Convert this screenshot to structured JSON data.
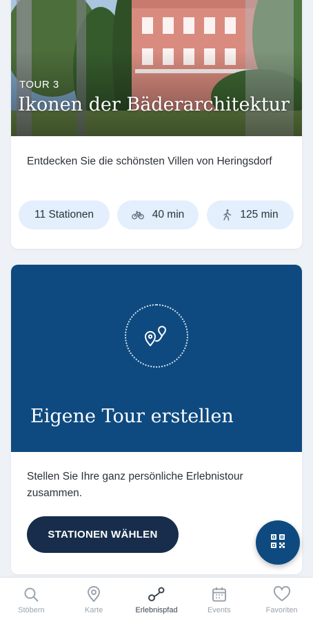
{
  "tour_card": {
    "eyebrow": "TOUR 3",
    "title": "Ikonen der Bäderarchitektur",
    "description": "Entdecken Sie die schönsten Villen von Heringsdorf",
    "chips": {
      "stations": "11 Stationen",
      "bike": "40 min",
      "walk": "125 min"
    }
  },
  "create_card": {
    "title": "Eigene Tour erstellen",
    "description": "Stellen Sie Ihre ganz persönliche Erlebnistour zusammen.",
    "button_label": "STATIONEN WÄHLEN"
  },
  "bottom_nav": {
    "items": [
      {
        "label": "Stöbern",
        "icon": "search-icon"
      },
      {
        "label": "Karte",
        "icon": "map-pin-icon"
      },
      {
        "label": "Erlebnispfad",
        "icon": "route-icon",
        "active": true
      },
      {
        "label": "Events",
        "icon": "calendar-icon"
      },
      {
        "label": "Favoriten",
        "icon": "heart-icon"
      }
    ]
  },
  "colors": {
    "primary_blue": "#0e4a80",
    "dark_navy": "#172d4b",
    "chip_bg": "#e3effc",
    "page_bg": "#eef1f6"
  },
  "fab": {
    "icon": "qr-code-icon"
  }
}
